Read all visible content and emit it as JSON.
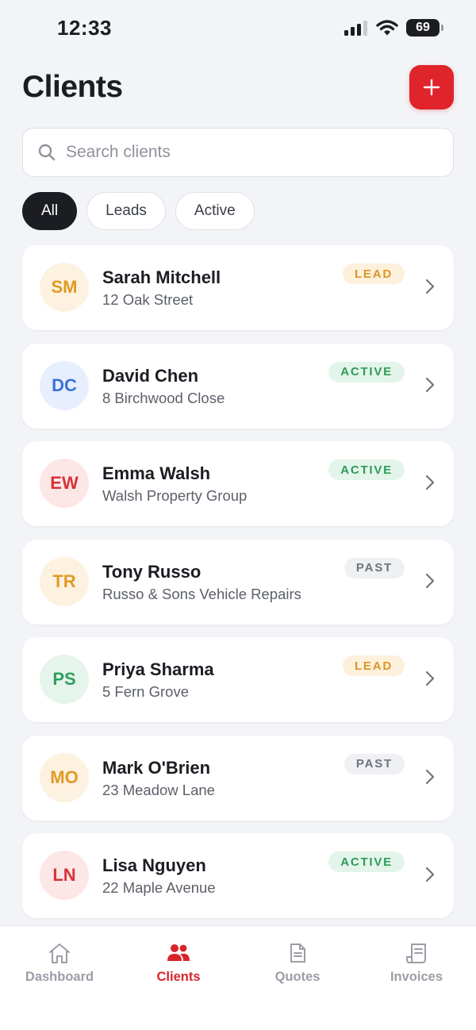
{
  "status_bar": {
    "time": "12:33",
    "battery": "69"
  },
  "header": {
    "title": "Clients",
    "add_icon": "plus-icon"
  },
  "search": {
    "placeholder": "Search clients",
    "value": ""
  },
  "filters": [
    {
      "label": "All",
      "selected": true
    },
    {
      "label": "Leads",
      "selected": false
    },
    {
      "label": "Active",
      "selected": false
    }
  ],
  "clients": [
    {
      "initials": "SM",
      "name": "Sarah Mitchell",
      "subtitle": "12 Oak Street",
      "status": "LEAD",
      "avatar_bg": "#fdf1e0",
      "avatar_fg": "#e09a24"
    },
    {
      "initials": "DC",
      "name": "David Chen",
      "subtitle": "8 Birchwood Close",
      "status": "ACTIVE",
      "avatar_bg": "#e7efff",
      "avatar_fg": "#3a72d8"
    },
    {
      "initials": "EW",
      "name": "Emma Walsh",
      "subtitle": "Walsh Property Group",
      "status": "ACTIVE",
      "avatar_bg": "#fde6e6",
      "avatar_fg": "#d8323a"
    },
    {
      "initials": "TR",
      "name": "Tony Russo",
      "subtitle": "Russo & Sons Vehicle Repairs",
      "status": "PAST",
      "avatar_bg": "#fdf1e0",
      "avatar_fg": "#e09a24"
    },
    {
      "initials": "PS",
      "name": "Priya Sharma",
      "subtitle": "5 Fern Grove",
      "status": "LEAD",
      "avatar_bg": "#e5f5ec",
      "avatar_fg": "#2f9e5e"
    },
    {
      "initials": "MO",
      "name": "Mark O'Brien",
      "subtitle": "23 Meadow Lane",
      "status": "PAST",
      "avatar_bg": "#fdf1e0",
      "avatar_fg": "#e09a24"
    },
    {
      "initials": "LN",
      "name": "Lisa Nguyen",
      "subtitle": "22 Maple Avenue",
      "status": "ACTIVE",
      "avatar_bg": "#fde6e6",
      "avatar_fg": "#d8323a"
    }
  ],
  "status_colors": {
    "LEAD": {
      "bg": "#fdf0dc",
      "fg": "#dd9522"
    },
    "ACTIVE": {
      "bg": "#e3f5ea",
      "fg": "#2f9a5a"
    },
    "PAST": {
      "bg": "#eef0f3",
      "fg": "#6e737c"
    }
  },
  "tabs": [
    {
      "label": "Dashboard",
      "icon": "home-icon",
      "active": false
    },
    {
      "label": "Clients",
      "icon": "people-icon",
      "active": true
    },
    {
      "label": "Quotes",
      "icon": "document-icon",
      "active": false
    },
    {
      "label": "Invoices",
      "icon": "receipt-icon",
      "active": false
    }
  ],
  "colors": {
    "accent": "#e0242b",
    "background": "#f3f4f7",
    "text": "#1b1d22"
  }
}
